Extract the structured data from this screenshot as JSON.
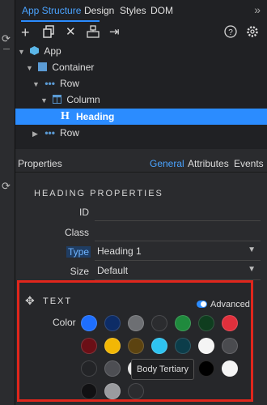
{
  "tabs": [
    "App Structure",
    "Design",
    "Styles",
    "DOM"
  ],
  "more_icon": "double-chevron-right",
  "toolbar_icons": [
    "plus-icon",
    "copy-icon",
    "close-icon",
    "component-icon",
    "arrow-right-icon",
    "help-icon",
    "settings-icon"
  ],
  "tree": [
    {
      "label": "App",
      "icon": "cube-icon"
    },
    {
      "label": "Container",
      "icon": "square-icon"
    },
    {
      "label": "Row",
      "icon": "dots-icon"
    },
    {
      "label": "Column",
      "icon": "column-icon"
    },
    {
      "label": "Heading",
      "icon": "heading-icon",
      "icon_char": "H"
    },
    {
      "label": "Row",
      "icon": "dots-icon"
    }
  ],
  "properties": {
    "title": "Properties",
    "tabs": [
      "General",
      "Attributes",
      "Events"
    ],
    "section": "HEADING PROPERTIES",
    "fields": {
      "id": {
        "label": "ID",
        "value": ""
      },
      "class": {
        "label": "Class",
        "value": ""
      },
      "type": {
        "label": "Type",
        "value": "Heading 1"
      },
      "size": {
        "label": "Size",
        "value": "Default"
      }
    }
  },
  "text_section": {
    "title": "TEXT",
    "advanced": "Advanced",
    "color_label": "Color",
    "swatches": [
      "#1e6fff",
      "#0d2c66",
      "#6d6f73",
      "#2b2c2f",
      "#1f8a3d",
      "#0f3d1f",
      "#e0303c",
      "#6b0f16",
      "#f2b705",
      "#5c4310",
      "#2ec3f0",
      "#0c3d4a",
      "#f4f4f4",
      "#4a4b4f",
      "#232427",
      "#4d4e53",
      "#e6e6e6",
      "#8d8e92",
      "#1b1b1d",
      "#000000",
      "#f5f5f5",
      "#111113",
      "#9a9b9f",
      "#2b2c2f"
    ],
    "tooltip": "Body Tertiary"
  }
}
